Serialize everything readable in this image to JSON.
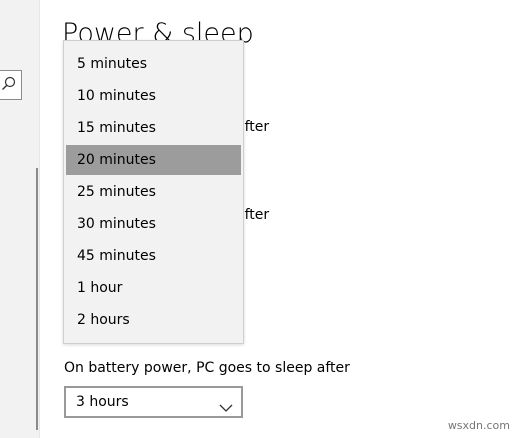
{
  "page": {
    "title": "Power & sleep"
  },
  "settings": {
    "hidden_label_1_tail": "after",
    "hidden_label_2_tail": "after",
    "battery_sleep_label": "On battery power, PC goes to sleep after",
    "battery_sleep_value": "3 hours"
  },
  "dropdown_menu": {
    "items": [
      {
        "label": "5 minutes"
      },
      {
        "label": "10 minutes"
      },
      {
        "label": "15 minutes"
      },
      {
        "label": "20 minutes"
      },
      {
        "label": "25 minutes"
      },
      {
        "label": "30 minutes"
      },
      {
        "label": "45 minutes"
      },
      {
        "label": "1 hour"
      },
      {
        "label": "2 hours"
      }
    ],
    "selected": "20 minutes"
  },
  "watermark": "wsxdn.com",
  "colors": {
    "selected_item_bg": "#9c9c9c",
    "menu_bg": "#f2f2f2",
    "sidebar_bg": "#f2f2f2"
  }
}
